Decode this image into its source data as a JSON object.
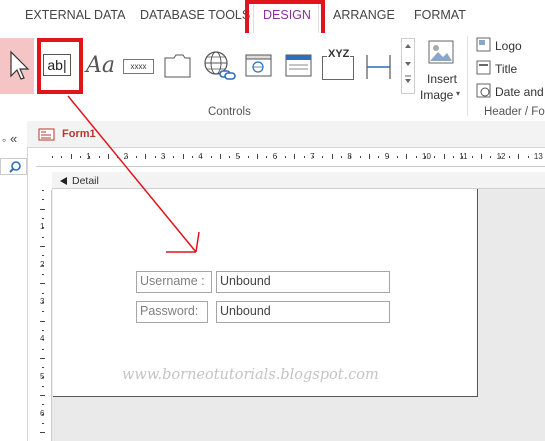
{
  "ribbon": {
    "tabs": [
      {
        "label": "EXTERNAL DATA",
        "active": false
      },
      {
        "label": "DATABASE TOOLS",
        "active": false
      },
      {
        "label": "DESIGN",
        "active": true
      },
      {
        "label": "ARRANGE",
        "active": false
      },
      {
        "label": "FORMAT",
        "active": false
      }
    ],
    "controls": {
      "textbox_icon_text": "ab|",
      "label_icon_text": "Aa",
      "button_icon_text": "xxxx",
      "xyz_icon_text": "XYZ",
      "insert_image_label": "Insert",
      "insert_image_label2": "Image",
      "group_label": "Controls"
    },
    "header_footer": {
      "logo_label": "Logo",
      "title_label": "Title",
      "date_label": "Date and",
      "group_label": "Header / Fo"
    }
  },
  "nav": {
    "collapse_label": "«"
  },
  "form": {
    "title": "Form1",
    "section_label": "Detail",
    "fields": [
      {
        "label": "Username :",
        "value": "Unbound"
      },
      {
        "label": "Password:",
        "value": "Unbound"
      }
    ]
  },
  "ruler": {
    "h_numbers": [
      "1",
      "2",
      "3",
      "4",
      "5",
      "6",
      "7",
      "8",
      "9",
      "10",
      "11",
      "12",
      "13"
    ],
    "v_numbers": [
      "1",
      "2",
      "3",
      "4",
      "5",
      "6"
    ]
  },
  "watermark": "www.borneotutorials.blogspot.com",
  "colors": {
    "accent": "#8b2fa0",
    "highlight": "#e0141b",
    "form_title": "#b5372e"
  }
}
